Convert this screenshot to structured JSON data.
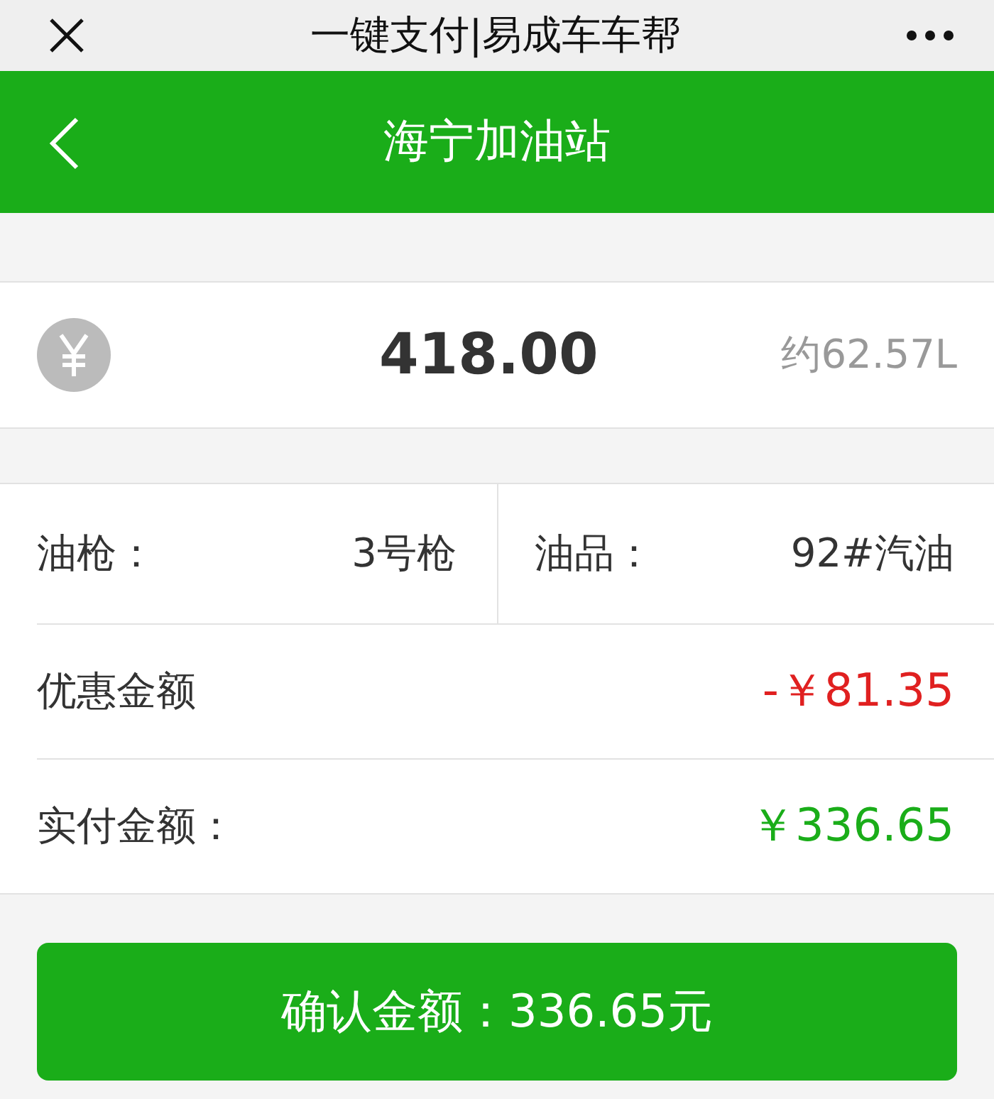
{
  "top_bar": {
    "title": "一键支付|易成车车帮"
  },
  "nav_bar": {
    "title": "海宁加油站"
  },
  "amount": {
    "value": "418.00",
    "volume": "约62.57L"
  },
  "details": [
    {
      "label": "油枪：",
      "value": "3号枪"
    },
    {
      "label": "油品：",
      "value": "92#汽油"
    }
  ],
  "summary": [
    {
      "label": "优惠金额",
      "value": "-￥81.35",
      "kind": "discount"
    },
    {
      "label": "实付金额：",
      "value": "￥336.65",
      "kind": "paid"
    }
  ],
  "confirm_button": {
    "label": "确认金额：336.65元"
  }
}
